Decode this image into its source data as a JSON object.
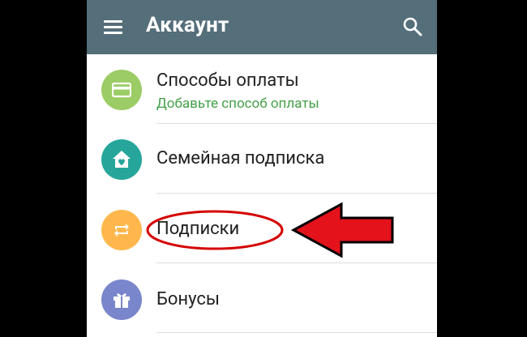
{
  "toolbar": {
    "title": "Аккаунт",
    "menu_icon": "hamburger-menu-icon",
    "search_icon": "search-icon",
    "background_color": "#546e7a"
  },
  "items": [
    {
      "title": "Способы оплаты",
      "subtitle": "Добавьте способ оплаты",
      "icon": "credit-card-icon",
      "icon_color": "#9ccc65"
    },
    {
      "title": "Семейная подписка",
      "icon": "family-home-heart-icon",
      "icon_color": "#26a69a"
    },
    {
      "title": "Подписки",
      "icon": "subscriptions-repeat-icon",
      "icon_color": "#ffb74d"
    },
    {
      "title": "Бонусы",
      "icon": "gift-icon",
      "icon_color": "#7986cb"
    }
  ],
  "annotation": {
    "ellipse_color": "#d50000",
    "arrow_color": "#e3121b"
  }
}
